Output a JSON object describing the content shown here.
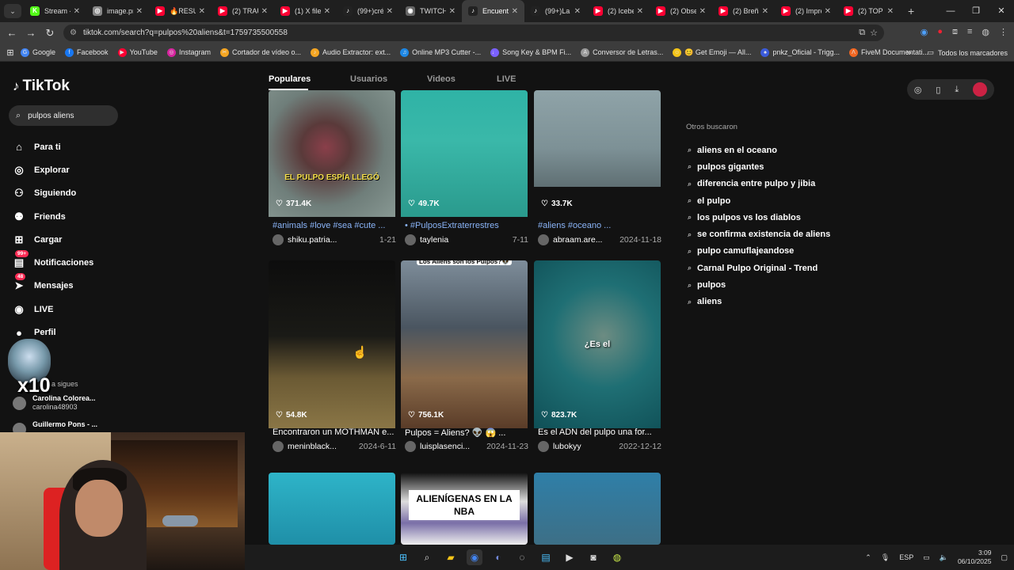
{
  "browser": {
    "tabs": [
      {
        "title": "Stream -",
        "color": "#53fc18",
        "glyph": "K"
      },
      {
        "title": "image.pr",
        "color": "#888",
        "glyph": "◎"
      },
      {
        "title": "🔥RESU",
        "color": "#ff0033",
        "glyph": "▶"
      },
      {
        "title": "(2) TRAU",
        "color": "#ff0033",
        "glyph": "▶"
      },
      {
        "title": "(1) X files",
        "color": "#ff0033",
        "glyph": "▶"
      },
      {
        "title": "(99+)cré",
        "color": "#222",
        "glyph": "♪"
      },
      {
        "title": "TWITCH",
        "color": "#666",
        "glyph": "◉"
      },
      {
        "title": "Encuentr",
        "color": "#222",
        "glyph": "♪"
      },
      {
        "title": "(99+)La",
        "color": "#222",
        "glyph": "♪"
      },
      {
        "title": "(2) Icebe",
        "color": "#ff0033",
        "glyph": "▶"
      },
      {
        "title": "(2) Obse",
        "color": "#ff0033",
        "glyph": "▶"
      },
      {
        "title": "(2) Breña",
        "color": "#ff0033",
        "glyph": "▶"
      },
      {
        "title": "(2) Impre",
        "color": "#ff0033",
        "glyph": "▶"
      },
      {
        "title": "(2) TOP",
        "color": "#ff0033",
        "glyph": "▶"
      }
    ],
    "url": "tiktok.com/search?q=pulpos%20aliens&t=1759735500558",
    "bookmarks": [
      {
        "label": "Google",
        "color": "#4285f4",
        "glyph": "G"
      },
      {
        "label": "Facebook",
        "color": "#1877f2",
        "glyph": "f"
      },
      {
        "label": "YouTube",
        "color": "#ff0033",
        "glyph": "▶"
      },
      {
        "label": "Instagram",
        "color": "#d6249f",
        "glyph": "◎"
      },
      {
        "label": "Cortador de vídeo o...",
        "color": "#f5a623",
        "glyph": "✂"
      },
      {
        "label": "Audio Extractor: ext...",
        "color": "#f5a623",
        "glyph": "♪"
      },
      {
        "label": "Online MP3 Cutter -...",
        "color": "#1e88e5",
        "glyph": "♫"
      },
      {
        "label": "Song Key & BPM Fi...",
        "color": "#7b61ff",
        "glyph": "♩"
      },
      {
        "label": "Conversor de Letras...",
        "color": "#999",
        "glyph": "A"
      },
      {
        "label": "😊 Get Emoji — All...",
        "color": "#f5c518",
        "glyph": "☺"
      },
      {
        "label": "pnkz_Oficial - Trigg...",
        "color": "#3b5bdb",
        "glyph": "♠"
      },
      {
        "label": "FiveM Documentati...",
        "color": "#f26722",
        "glyph": "Λ"
      }
    ],
    "all_bookmarks": "Todos los marcadores"
  },
  "tiktok": {
    "logo": "TikTok",
    "search_value": "pulpos aliens",
    "nav": [
      {
        "label": "Para ti",
        "icon": "⌂",
        "badge": ""
      },
      {
        "label": "Explorar",
        "icon": "◎",
        "badge": ""
      },
      {
        "label": "Siguiendo",
        "icon": "⚇",
        "badge": ""
      },
      {
        "label": "Friends",
        "icon": "⚉",
        "badge": ""
      },
      {
        "label": "Cargar",
        "icon": "⊞",
        "badge": ""
      },
      {
        "label": "Notificaciones",
        "icon": "▤",
        "badge": "99+"
      },
      {
        "label": "Mensajes",
        "icon": "➤",
        "badge": "48"
      },
      {
        "label": "LIVE",
        "icon": "◉",
        "badge": ""
      },
      {
        "label": "Perfil",
        "icon": "●",
        "badge": ""
      },
      {
        "label": "s",
        "icon": "",
        "badge": ""
      }
    ],
    "following_label": "Cuentas que sigues",
    "following_visible": "La sigues",
    "following": [
      {
        "name": "Carolina Colorea...",
        "handle": "carolina48903"
      },
      {
        "name": "Guillermo Pons - ...",
        "handle": ""
      }
    ],
    "search_tabs": [
      "Populares",
      "Usuarios",
      "Videos",
      "LIVE"
    ],
    "videos": [
      {
        "likes": "371.4K",
        "caption": "#animals #love #sea #cute ...",
        "author": "shiku.patria...",
        "date": "1-21",
        "overlay": "EL PULPO ESPÍA LLEGÓ",
        "tag": true
      },
      {
        "likes": "49.7K",
        "caption": "• #PulposExtraterrestres",
        "author": "taylenia",
        "date": "7-11",
        "overlay": "",
        "tag": true
      },
      {
        "likes": "33.7K",
        "caption": "#aliens #oceano ...",
        "author": "abraam.are...",
        "date": "2024-11-18",
        "overlay": "",
        "tag": true
      },
      {
        "likes": "54.8K",
        "caption": "Encontraron un MOTHMAN e...",
        "author": "meninblack...",
        "date": "2024-6-11",
        "overlay": "",
        "tag": false
      },
      {
        "likes": "756.1K",
        "caption": "Pulpos = Aliens? 👽 😱 ...",
        "author": "luisplasenci...",
        "date": "2024-11-23",
        "overlay": "Los Aliens son los Pulpos?👽",
        "tag": false
      },
      {
        "likes": "823.7K",
        "caption": "Es el ADN del pulpo una for...",
        "author": "lubokyy",
        "date": "2022-12-12",
        "overlay": "¿Es el",
        "tag": false
      },
      {
        "likes": "",
        "caption": "",
        "author": "",
        "date": "",
        "overlay": "",
        "tag": false
      },
      {
        "likes": "",
        "caption": "",
        "author": "",
        "date": "",
        "overlay": "ALIENÍGENAS EN LA NBA",
        "tag": false
      },
      {
        "likes": "",
        "caption": "",
        "author": "",
        "date": "",
        "overlay": "",
        "tag": false
      }
    ],
    "others_title": "Otros buscaron",
    "others": [
      "aliens en el oceano",
      "pulpos gigantes",
      "diferencia entre pulpo y jibia",
      "el pulpo",
      "los pulpos vs los diablos",
      "se confirma existencia de aliens",
      "pulpo camuflajeandose",
      "Carnal Pulpo Original - Trend",
      "pulpos",
      "aliens"
    ]
  },
  "overlay": {
    "popup_text": "x10"
  },
  "taskbar": {
    "lang": "ESP",
    "time": "3:09",
    "date": "06/10/2025"
  }
}
